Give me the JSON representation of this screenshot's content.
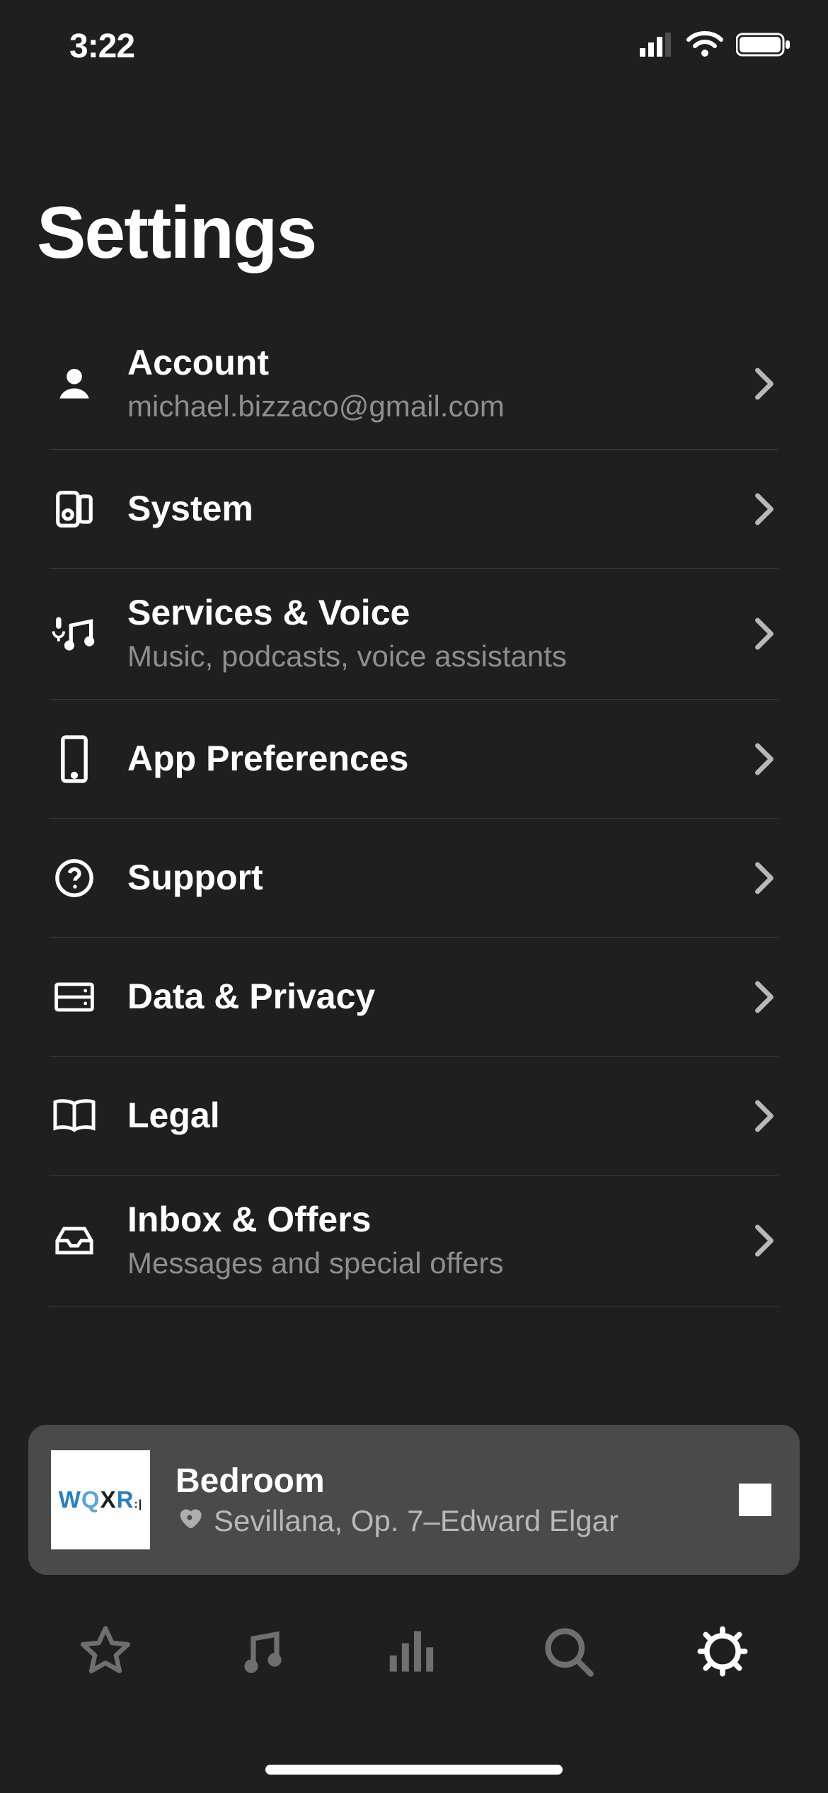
{
  "status": {
    "time": "3:22"
  },
  "title": "Settings",
  "items": [
    {
      "icon": "person",
      "label": "Account",
      "sublabel": "michael.bizzaco@gmail.com"
    },
    {
      "icon": "system",
      "label": "System",
      "sublabel": null
    },
    {
      "icon": "services",
      "label": "Services & Voice",
      "sublabel": "Music, podcasts, voice assistants"
    },
    {
      "icon": "phone",
      "label": "App Preferences",
      "sublabel": null
    },
    {
      "icon": "help",
      "label": "Support",
      "sublabel": null
    },
    {
      "icon": "data",
      "label": "Data & Privacy",
      "sublabel": null
    },
    {
      "icon": "legal",
      "label": "Legal",
      "sublabel": null
    },
    {
      "icon": "inbox",
      "label": "Inbox & Offers",
      "sublabel": "Messages and special offers"
    }
  ],
  "now_playing": {
    "art_brand": "WQXR",
    "room": "Bedroom",
    "track": "Sevillana, Op. 7–Edward Elgar"
  }
}
